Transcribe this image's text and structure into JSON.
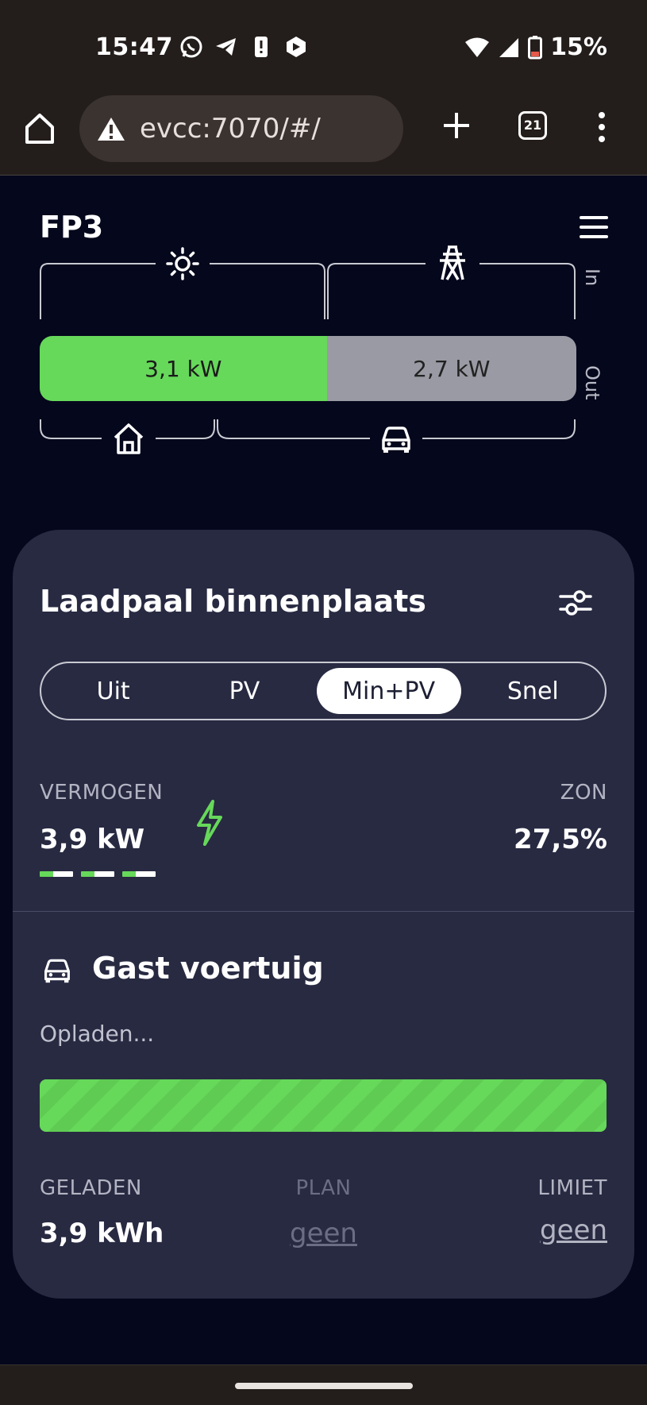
{
  "status_bar": {
    "time": "15:47",
    "notification_icons": [
      "whatsapp-icon",
      "telegram-icon",
      "alert-icon",
      "app-icon"
    ],
    "battery_percent": "15%",
    "icons": [
      "wifi-icon",
      "signal-icon",
      "battery-icon"
    ]
  },
  "browser": {
    "url": "evcc:7070/#/",
    "tab_count": "21",
    "security": "not-secure"
  },
  "header": {
    "title": "FP3"
  },
  "energy_flow": {
    "pv_power": "3,1 kW",
    "grid_power": "2,7 kW",
    "in_label": "In",
    "out_label": "Out",
    "pv_share": 0.535,
    "colors": {
      "pv": "#66d85a",
      "grid": "#999aa3"
    }
  },
  "loadpoint": {
    "title": "Laadpaal binnenplaats",
    "modes": [
      "Uit",
      "PV",
      "Min+PV",
      "Snel"
    ],
    "active_mode": "Min+PV",
    "power_label": "VERMOGEN",
    "power_value": "3,9 kW",
    "solar_label": "ZON",
    "solar_value": "27,5%",
    "phases_active": 3,
    "vehicle": {
      "name": "Gast voertuig",
      "status": "Opladen...",
      "progress": 1.0,
      "charged_label": "GELADEN",
      "charged_value": "3,9 kWh",
      "plan_label": "PLAN",
      "plan_value": "geen",
      "limit_label": "LIMIET",
      "limit_value": "geen"
    }
  }
}
